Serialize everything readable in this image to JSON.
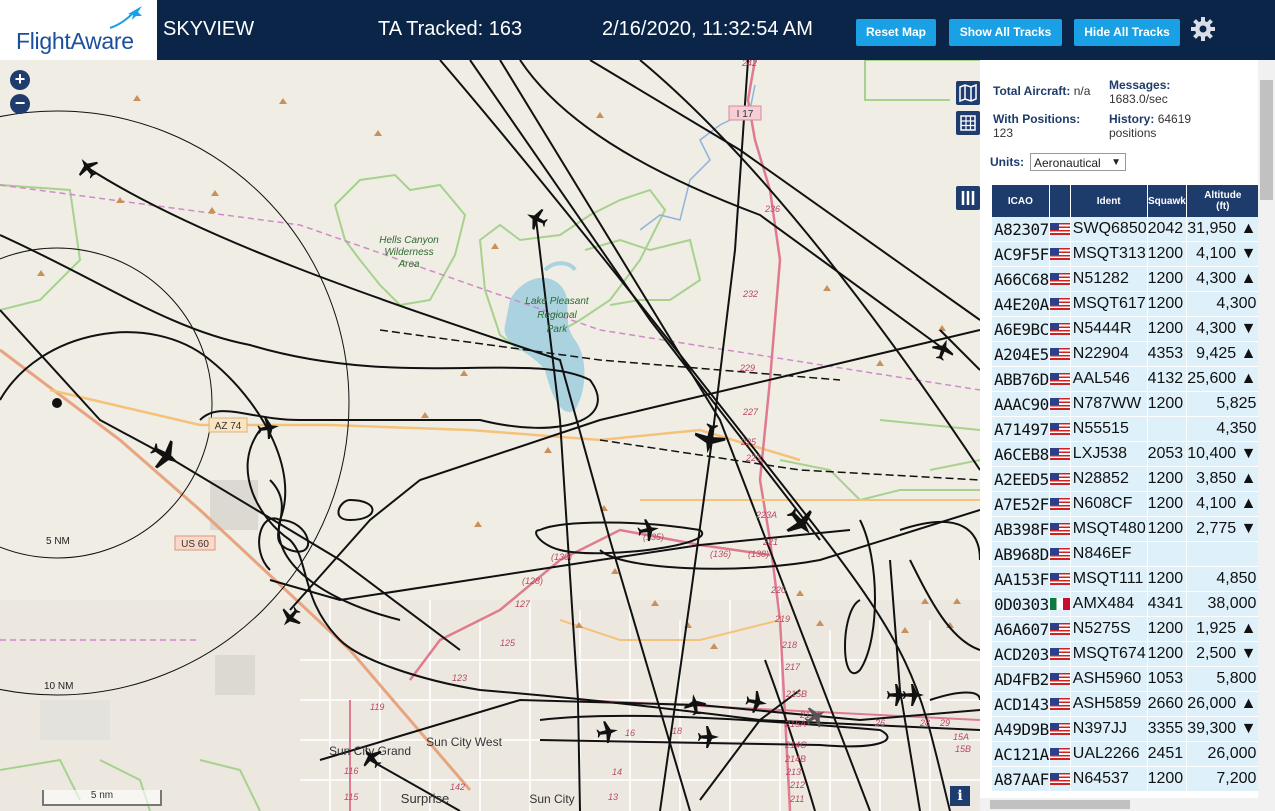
{
  "header": {
    "logo": "FlightAware",
    "title": "SKYVIEW",
    "tracked": "TA Tracked: 163",
    "datetime": "2/16/2020, 11:32:54 AM",
    "reset_map": "Reset Map",
    "show_all_tracks": "Show All Tracks",
    "hide_all_tracks": "Hide All Tracks",
    "settings_icon": "gear-icon"
  },
  "map": {
    "zoom_in": "+",
    "zoom_out": "−",
    "scale_label": "5 nm",
    "info": "i",
    "ring_5nm": "5 NM",
    "ring_10nm": "10 NM",
    "places": {
      "hells_canyon": "Hells Canyon",
      "wilderness": "Wilderness",
      "area": "Area",
      "lake_pleasant": "Lake Pleasant",
      "regional": "Regional",
      "park": "Park",
      "sun_city_west": "Sun City West",
      "sun_city_grand": "Sun City Grand",
      "surprise": "Surprise",
      "sun_city": "Sun City"
    },
    "roads": {
      "az74": "AZ 74",
      "us60": "US 60",
      "i17": "I 17"
    },
    "exits": [
      "242",
      "236",
      "232",
      "229",
      "227",
      "225",
      "223",
      "223A",
      "221",
      "220",
      "219",
      "218",
      "217",
      "215B",
      "215A",
      "214C",
      "214B",
      "214A",
      "213",
      "212",
      "211",
      "15A",
      "15B",
      "(135)",
      "(130)",
      "(128)",
      "127",
      "125",
      "123",
      "(136)",
      "(138)",
      "119",
      "116",
      "115",
      "142",
      "14",
      "13",
      "18",
      "16",
      "28",
      "29",
      "26"
    ]
  },
  "panel": {
    "total_aircraft_label": "Total Aircraft:",
    "total_aircraft_value": "n/a",
    "with_positions_label": "With Positions:",
    "with_positions_value": "123",
    "messages_label": "Messages:",
    "messages_value": "1683.0/sec",
    "history_label": "History:",
    "history_value": "64619",
    "history_unit": "positions",
    "units_label": "Units:",
    "units_value": "Aeronautical"
  },
  "table": {
    "headers": {
      "icao": "ICAO",
      "ident": "Ident",
      "squawk": "Squawk",
      "altitude": "Altitude",
      "altitude_unit": "(ft)"
    },
    "rows": [
      {
        "icao": "A82307",
        "flag": "us",
        "ident": "SWQ6850",
        "squawk": "2042",
        "alt": "31,950 ▲"
      },
      {
        "icao": "AC9F5F",
        "flag": "us",
        "ident": "MSQT313",
        "squawk": "1200",
        "alt": "4,100 ▼"
      },
      {
        "icao": "A66C68",
        "flag": "us",
        "ident": "N51282",
        "squawk": "1200",
        "alt": "4,300 ▲"
      },
      {
        "icao": "A4E20A",
        "flag": "us",
        "ident": "MSQT617",
        "squawk": "1200",
        "alt": "4,300"
      },
      {
        "icao": "A6E9BC",
        "flag": "us",
        "ident": "N5444R",
        "squawk": "1200",
        "alt": "4,300 ▼"
      },
      {
        "icao": "A204E5",
        "flag": "us",
        "ident": "N22904",
        "squawk": "4353",
        "alt": "9,425 ▲"
      },
      {
        "icao": "ABB76D",
        "flag": "us",
        "ident": "AAL546",
        "squawk": "4132",
        "alt": "25,600 ▲"
      },
      {
        "icao": "AAAC90",
        "flag": "us",
        "ident": "N787WW",
        "squawk": "1200",
        "alt": "5,825"
      },
      {
        "icao": "A71497",
        "flag": "us",
        "ident": "N55515",
        "squawk": "",
        "alt": "4,350"
      },
      {
        "icao": "A6CEB8",
        "flag": "us",
        "ident": "LXJ538",
        "squawk": "2053",
        "alt": "10,400 ▼"
      },
      {
        "icao": "A2EED5",
        "flag": "us",
        "ident": "N28852",
        "squawk": "1200",
        "alt": "3,850 ▲"
      },
      {
        "icao": "A7E52F",
        "flag": "us",
        "ident": "N608CF",
        "squawk": "1200",
        "alt": "4,100 ▲"
      },
      {
        "icao": "AB398F",
        "flag": "us",
        "ident": "MSQT480",
        "squawk": "1200",
        "alt": "2,775 ▼"
      },
      {
        "icao": "AB968D",
        "flag": "us",
        "ident": "N846EF",
        "squawk": "",
        "alt": ""
      },
      {
        "icao": "AA153F",
        "flag": "us",
        "ident": "MSQT111",
        "squawk": "1200",
        "alt": "4,850"
      },
      {
        "icao": "0D0303",
        "flag": "mx",
        "ident": "AMX484",
        "squawk": "4341",
        "alt": "38,000"
      },
      {
        "icao": "A6A607",
        "flag": "us",
        "ident": "N5275S",
        "squawk": "1200",
        "alt": "1,925 ▲"
      },
      {
        "icao": "ACD203",
        "flag": "us",
        "ident": "MSQT674",
        "squawk": "1200",
        "alt": "2,500 ▼"
      },
      {
        "icao": "AD4FB2",
        "flag": "us",
        "ident": "ASH5960",
        "squawk": "1053",
        "alt": "5,800"
      },
      {
        "icao": "ACD143",
        "flag": "us",
        "ident": "ASH5859",
        "squawk": "2660",
        "alt": "26,000 ▲"
      },
      {
        "icao": "A49D9B",
        "flag": "us",
        "ident": "N397JJ",
        "squawk": "3355",
        "alt": "39,300 ▼"
      },
      {
        "icao": "AC121A",
        "flag": "us",
        "ident": "UAL2266",
        "squawk": "2451",
        "alt": "26,000"
      },
      {
        "icao": "A87AAF",
        "flag": "us",
        "ident": "N64537",
        "squawk": "1200",
        "alt": "7,200"
      }
    ]
  },
  "colors": {
    "header_bg": "#0b2548",
    "button": "#1aa0e4",
    "table_header": "#1d3b6b",
    "row_bg": "#def0fa"
  }
}
